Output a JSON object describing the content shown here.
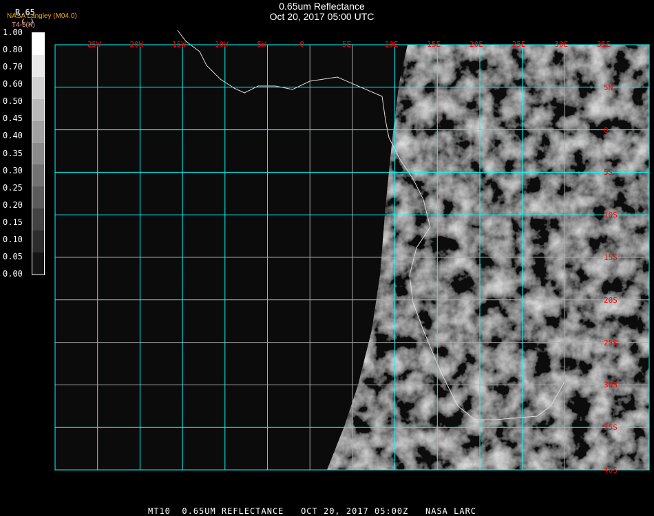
{
  "header": {
    "title": "0.65um Reflectance",
    "subtitle": "Oct 20, 2017 05:00 UTC"
  },
  "legend": {
    "product": "NASA Langley (M04.0)",
    "channel": "R.65",
    "units": "( )",
    "secondary": "T4-5(K)",
    "ticks": [
      "1.00",
      "0.80",
      "0.70",
      "0.60",
      "0.50",
      "0.45",
      "0.40",
      "0.35",
      "0.30",
      "0.25",
      "0.20",
      "0.15",
      "0.10",
      "0.05",
      "0.00"
    ]
  },
  "map": {
    "lon_labels": [
      "25W",
      "20W",
      "15W",
      "10W",
      "5W",
      "0",
      "5E",
      "10E",
      "15E",
      "20E",
      "25E",
      "30E",
      "35E"
    ],
    "lat_labels": [
      "5N",
      "0",
      "5S",
      "10S",
      "15S",
      "20S",
      "25S",
      "30S",
      "35S",
      "40S"
    ],
    "grid_color": "#00ffff",
    "label_color": "#ff0000"
  },
  "footer": {
    "text": "MT10  0.65UM REFLECTANCE   OCT 20, 2017 05:00Z   NASA LARC"
  }
}
